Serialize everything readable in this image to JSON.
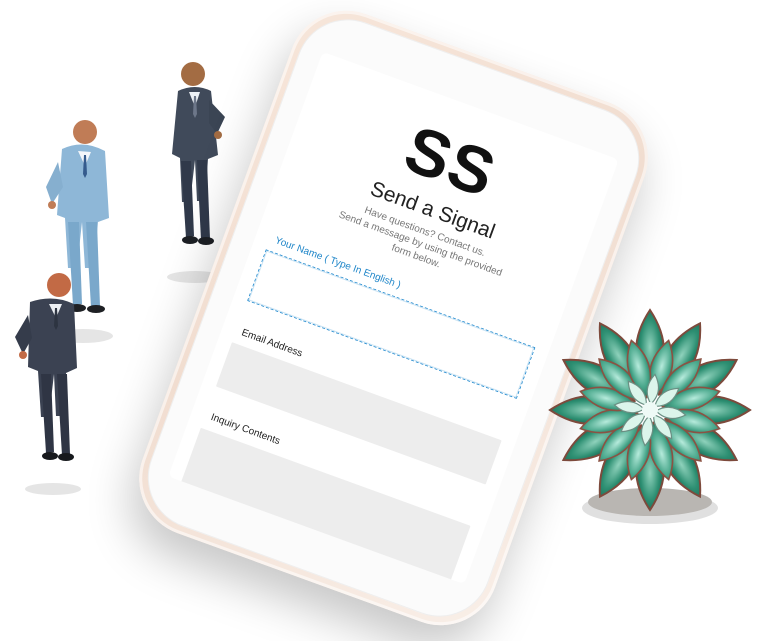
{
  "form": {
    "logo_text": "SS",
    "title": "Send a Signal",
    "subtitle_line1": "Have questions? Contact us.",
    "subtitle_line2": "Send a message by using the provided",
    "subtitle_line3": "form below.",
    "name_label": "Your Name ( Type In English )",
    "email_label": "Email Address",
    "inquiry_label": "Inquiry Contents"
  },
  "decor": {
    "left_figures": [
      "businessman-figurine-left",
      "businessman-figurine-middle",
      "businessman-figurine-right"
    ],
    "right_plant": "succulent-plant"
  },
  "colors": {
    "accent": "#1f86c9",
    "field": "#ededed",
    "phone_frame": "#f4e2d6"
  }
}
